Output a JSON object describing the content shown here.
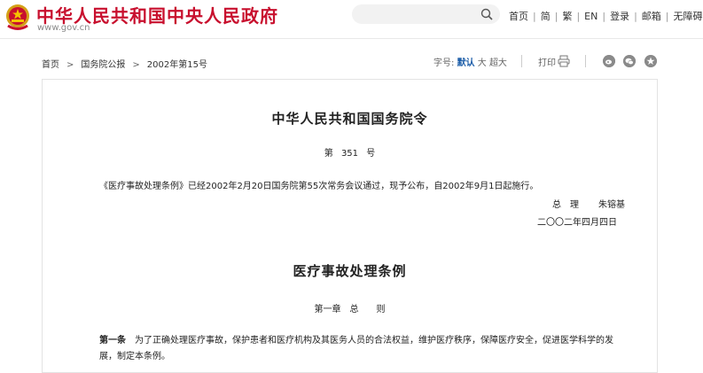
{
  "header": {
    "site_title": "中华人民共和国中央人民政府",
    "site_url": "www.gov.cn",
    "search_placeholder": "",
    "nav": [
      "首页",
      "简",
      "繁",
      "EN",
      "登录",
      "邮箱",
      "无障碍"
    ]
  },
  "breadcrumb": {
    "items": [
      "首页",
      "国务院公报",
      "2002年第15号"
    ]
  },
  "toolbar": {
    "font_label": "字号:",
    "font_default": "默认",
    "font_large": "大",
    "font_xlarge": "超大",
    "print_label": "打印"
  },
  "share_icons": [
    "weibo-icon",
    "wechat-icon",
    "favorite-icon"
  ],
  "article": {
    "title": "中华人民共和国国务院令",
    "order_number": "第 351 号",
    "intro": "《医疗事故处理条例》已经2002年2月20日国务院第55次常务会议通过，现予公布，自2002年9月1日起施行。",
    "signer_title": "总　理",
    "signer_name": "朱镕基",
    "sign_date": "二〇〇二年四月四日",
    "regulation_title": "医疗事故处理条例",
    "chapter": "第一章　总　　则",
    "article1_lead": "第一条",
    "article1_text": "为了正确处理医疗事故，保护患者和医疗机构及其医务人员的合法权益，维护医疗秩序，保障医疗安全，促进医学科学的发展，制定本条例。"
  },
  "colors": {
    "brand_red": "#c8102e",
    "link_blue": "#1a5ca8"
  }
}
